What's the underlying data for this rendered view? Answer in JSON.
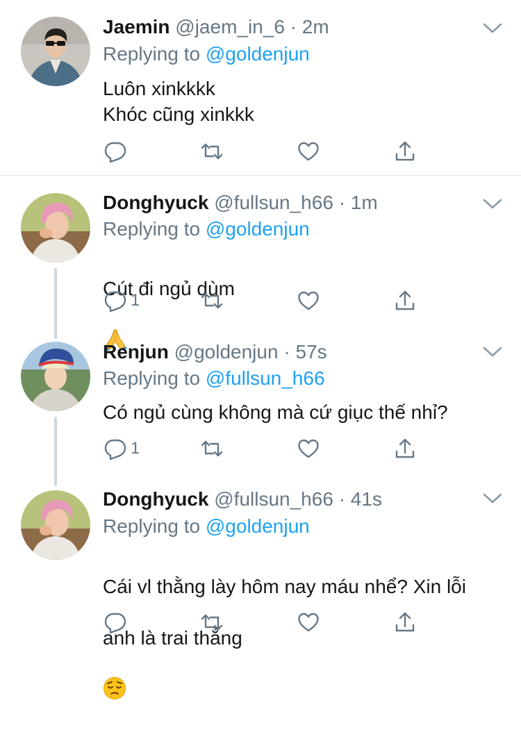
{
  "colors": {
    "text": "#14171a",
    "secondary": "#657786",
    "link": "#1da1f2",
    "divider": "#e1e8ed"
  },
  "tweets": [
    {
      "name": "Jaemin",
      "handle": "@jaem_in_6",
      "separator": "·",
      "time": "2m",
      "reply_prefix": "Replying to ",
      "reply_to": "@goldenjun",
      "text": "Luôn xinkkkk\nKhóc cũng xinkkk",
      "reply_count": "",
      "avatar": "avatar-jaemin"
    },
    {
      "name": "Donghyuck",
      "handle": "@fullsun_h66",
      "separator": "·",
      "time": "1m",
      "reply_prefix": "Replying to ",
      "reply_to": "@goldenjun",
      "text": "Cút đi ngủ dùm",
      "emoji": "folded-hands-emoji",
      "reply_count": "1",
      "avatar": "avatar-donghyuck"
    },
    {
      "name": "Renjun",
      "handle": "@goldenjun",
      "separator": "·",
      "time": "57s",
      "reply_prefix": "Replying to ",
      "reply_to": "@fullsun_h66",
      "text": "Có ngủ cùng không mà cứ giục thế nhỉ?",
      "reply_count": "1",
      "avatar": "avatar-renjun"
    },
    {
      "name": "Donghyuck",
      "handle": "@fullsun_h66",
      "separator": "·",
      "time": "41s",
      "reply_prefix": "Replying to ",
      "reply_to": "@goldenjun",
      "text_line1": "Cái vl thằng lày hôm nay máu nhể? Xin lỗi",
      "text_line2": "anh là trai thẳng",
      "emoji": "pensive-face-emoji",
      "reply_count": "",
      "avatar": "avatar-donghyuck"
    }
  ],
  "icons": {
    "reply": "reply-icon",
    "retweet": "retweet-icon",
    "like": "like-icon",
    "share": "share-icon",
    "menu": "chevron-down-icon"
  }
}
